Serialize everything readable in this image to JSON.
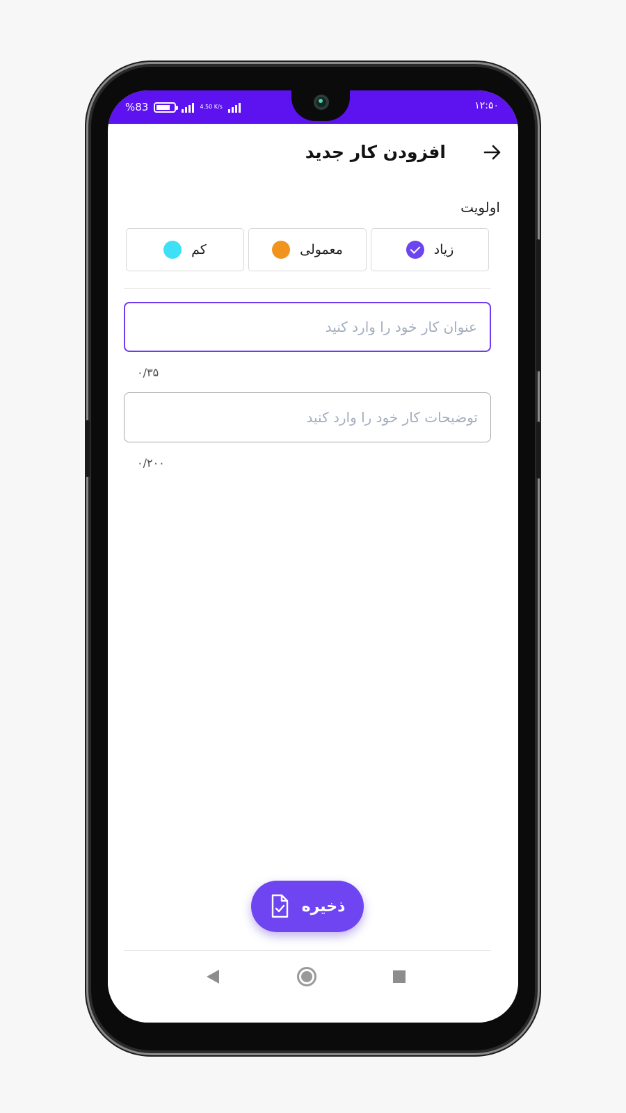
{
  "status_bar": {
    "battery_percent": "%83",
    "network_speed": "4.50 K/s",
    "time": "۱۲:۵۰"
  },
  "header": {
    "title": "افزودن کار جدید",
    "back_icon": "arrow-right-icon"
  },
  "priority": {
    "label": "اولویت",
    "options": [
      {
        "label": "زیاد",
        "color": "#6d45ee",
        "selected": true
      },
      {
        "label": "معمولی",
        "color": "#f0941d",
        "selected": false
      },
      {
        "label": "کم",
        "color": "#3ee0f5",
        "selected": false
      }
    ]
  },
  "title_field": {
    "placeholder": "عنوان کار خود را وارد کنید",
    "value": "",
    "counter": "۰/۳۵"
  },
  "description_field": {
    "placeholder": "توضیحات کار خود را وارد کنید",
    "value": "",
    "counter": "۰/۲۰۰"
  },
  "save_button": {
    "label": "ذخیره",
    "icon": "document-check-icon"
  },
  "navigation": {
    "back_icon": "triangle-back-icon",
    "home_icon": "circle-home-icon",
    "recents_icon": "square-recents-icon"
  },
  "colors": {
    "status_bar": "#5d12f0",
    "accent": "#6f45f2",
    "focused_border": "#6d3bf0",
    "placeholder": "#a3adbd"
  }
}
